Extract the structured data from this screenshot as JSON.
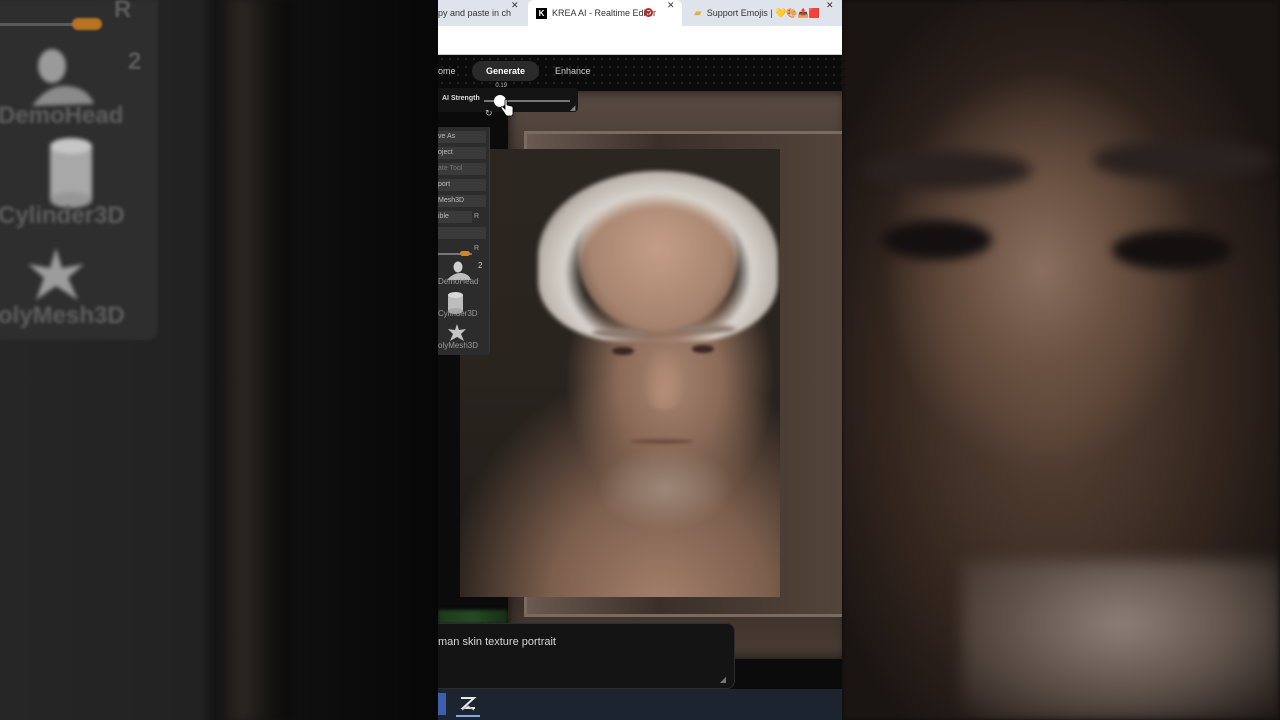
{
  "background_left": {
    "slider_letter": "R",
    "count": "2",
    "labels": [
      "DemoHead",
      "Cylinder3D",
      "olyMesh3D"
    ]
  },
  "browser": {
    "tabs": [
      {
        "label": "py and paste in ch",
        "close": "✕"
      },
      {
        "label": "KREA AI - Realtime Editor",
        "favicon": "K",
        "close": "✕",
        "active": true
      },
      {
        "label": "Support Emojis | 💛🎨📤🟥 |",
        "close": "✕"
      }
    ]
  },
  "krea": {
    "nav": {
      "home": "ome",
      "generate": "Generate",
      "enhance": "Enhance"
    },
    "ai_strength": {
      "label": "AI Strength",
      "value": "0.19",
      "fraction": 0.19
    },
    "prompt": "man skin texture portrait"
  },
  "zbrush_panel": {
    "buttons": [
      {
        "label": "ve As",
        "dim": false
      },
      {
        "label": "oject",
        "dim": false
      },
      {
        "label": "ate Tool",
        "dim": true
      },
      {
        "label": "port",
        "dim": false
      },
      {
        "label": "Mesh3D",
        "dim": false
      },
      {
        "label": "ible",
        "dim": false,
        "tag": "R"
      }
    ],
    "slider_tag": "R",
    "tools": [
      {
        "label": "DemoHead",
        "count": "2"
      },
      {
        "label": "Cylinder3D"
      },
      {
        "label": "olyMesh3D"
      }
    ]
  },
  "colors": {
    "accent_orange": "#d4852b",
    "chrome_tabbar": "#dfe3eb",
    "app_bg": "#0b0b0b"
  }
}
